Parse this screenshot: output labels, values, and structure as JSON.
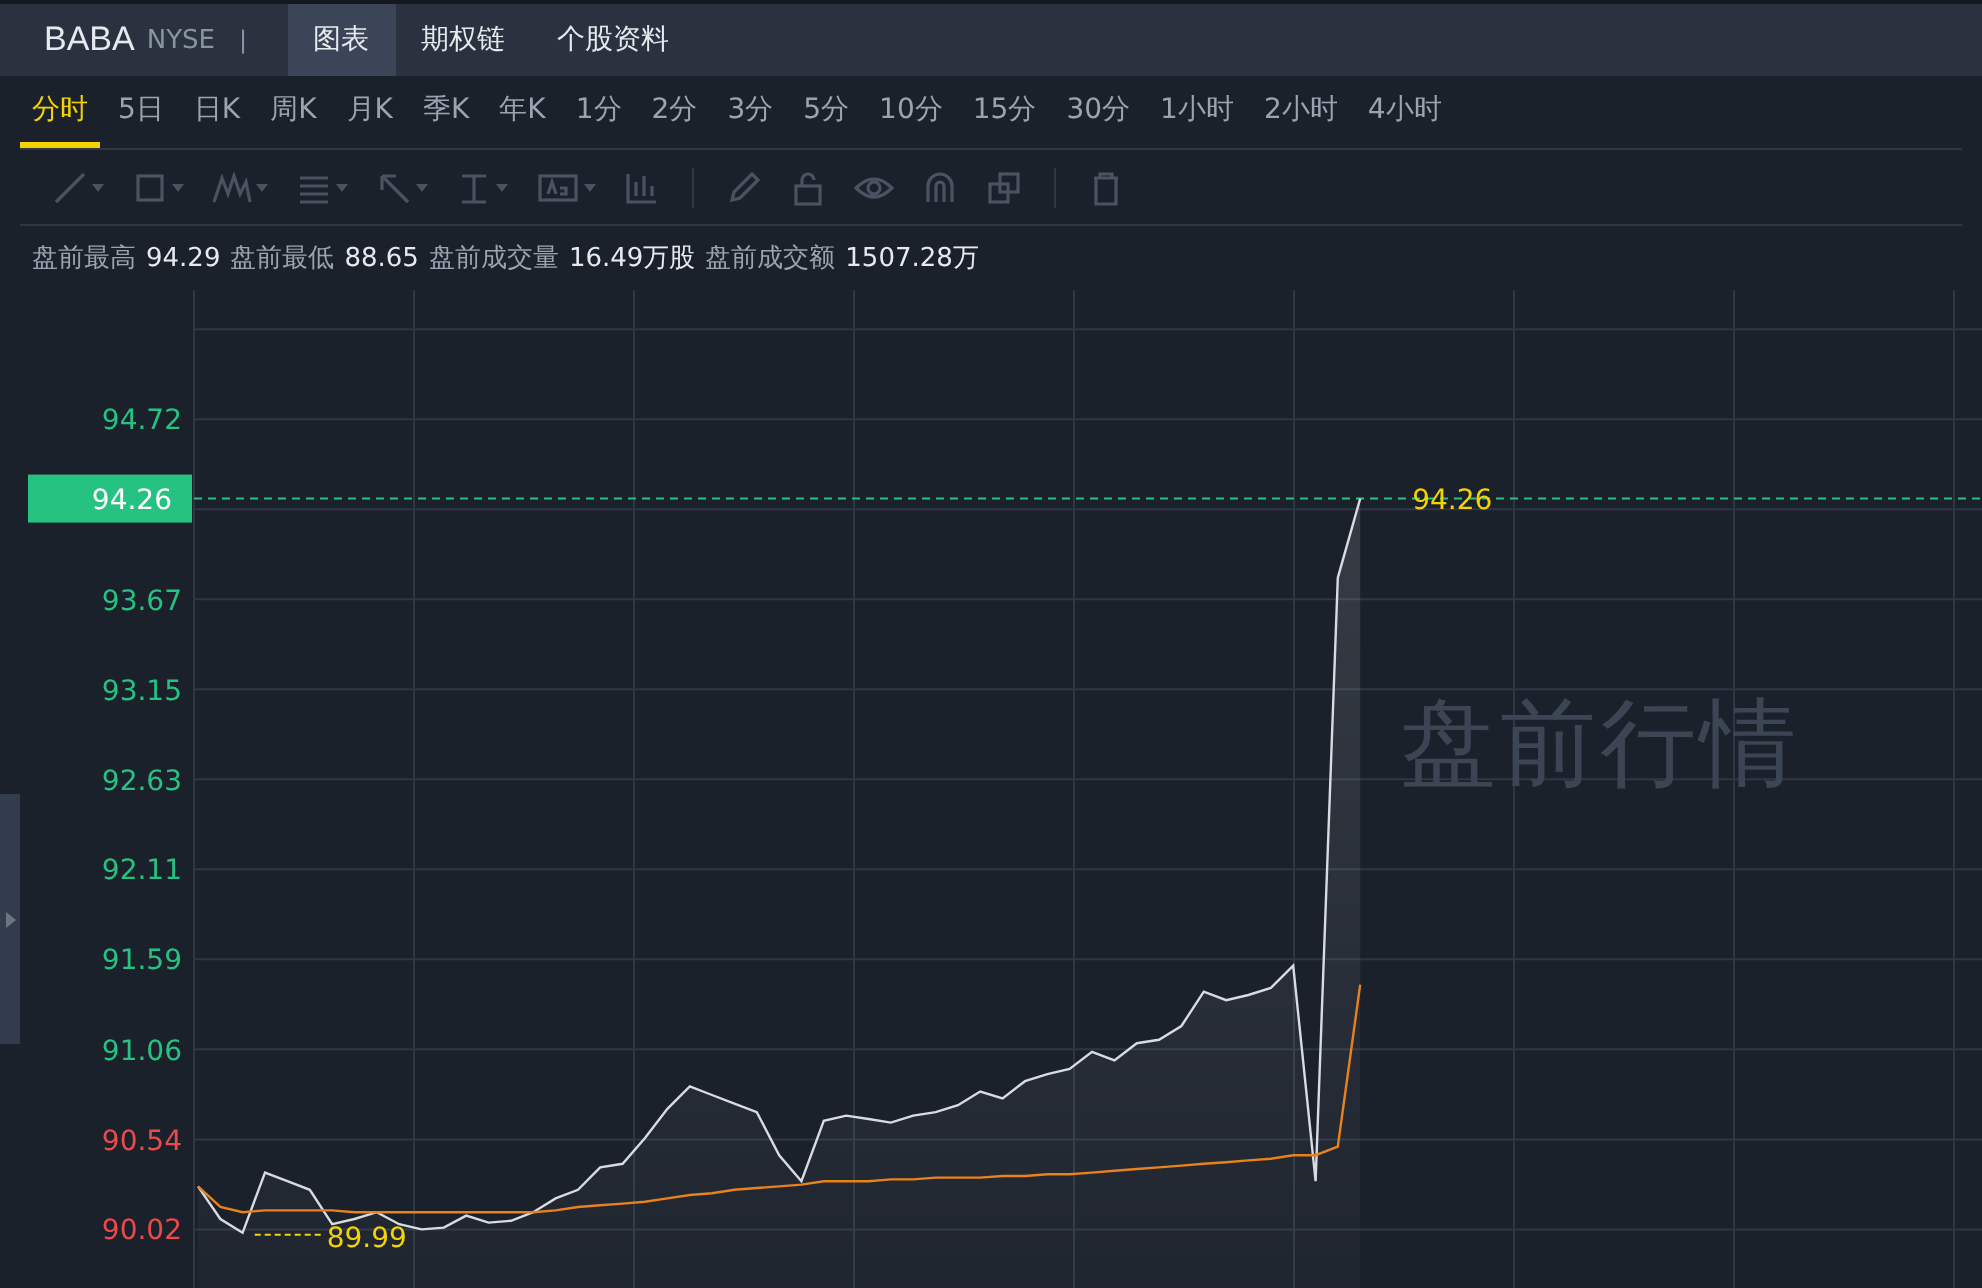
{
  "header": {
    "symbol": "BABA",
    "exchange": "NYSE",
    "separator": "|",
    "tabs": [
      {
        "label": "图表",
        "selected": true
      },
      {
        "label": "期权链",
        "selected": false
      },
      {
        "label": "个股资料",
        "selected": false
      }
    ]
  },
  "periods": [
    {
      "label": "分时",
      "selected": true
    },
    {
      "label": "5日",
      "selected": false
    },
    {
      "label": "日K",
      "selected": false
    },
    {
      "label": "周K",
      "selected": false
    },
    {
      "label": "月K",
      "selected": false
    },
    {
      "label": "季K",
      "selected": false
    },
    {
      "label": "年K",
      "selected": false
    },
    {
      "label": "1分",
      "selected": false
    },
    {
      "label": "2分",
      "selected": false
    },
    {
      "label": "3分",
      "selected": false
    },
    {
      "label": "5分",
      "selected": false
    },
    {
      "label": "10分",
      "selected": false
    },
    {
      "label": "15分",
      "selected": false
    },
    {
      "label": "30分",
      "selected": false
    },
    {
      "label": "1小时",
      "selected": false
    },
    {
      "label": "2小时",
      "selected": false
    },
    {
      "label": "4小时",
      "selected": false
    }
  ],
  "drawing_tools": [
    {
      "kind": "line",
      "menu": true
    },
    {
      "kind": "rect",
      "menu": true
    },
    {
      "kind": "pattern",
      "menu": true
    },
    {
      "kind": "fib",
      "menu": true
    },
    {
      "kind": "arrow",
      "menu": true
    },
    {
      "kind": "measure",
      "menu": true
    },
    {
      "kind": "text",
      "menu": true
    },
    {
      "kind": "bars",
      "menu": false
    },
    {
      "kind": "divider"
    },
    {
      "kind": "pencil",
      "menu": false
    },
    {
      "kind": "lock",
      "menu": false
    },
    {
      "kind": "eye",
      "menu": false
    },
    {
      "kind": "magnet",
      "menu": false
    },
    {
      "kind": "layers",
      "menu": false
    },
    {
      "kind": "divider"
    },
    {
      "kind": "trash",
      "menu": false
    }
  ],
  "stats": [
    {
      "label": "盘前最高",
      "value": "94.29"
    },
    {
      "label": "盘前最低",
      "value": "88.65"
    },
    {
      "label": "盘前成交量",
      "value": "16.49万股"
    },
    {
      "label": "盘前成交额",
      "value": "1507.28万"
    }
  ],
  "chart": {
    "watermark": "盘前行情",
    "tick_styles": [
      {
        "color": "#26c281"
      },
      {
        "color": "#26c281"
      },
      {
        "color": "#26c281"
      },
      {
        "color": "#26c281"
      },
      {
        "color": "#26c281"
      },
      {
        "color": "#26c281"
      },
      {
        "color": "#26c281"
      },
      {
        "color": "#e94a4a"
      },
      {
        "color": "#e94a4a"
      }
    ],
    "chart_data": {
      "type": "area",
      "grid": true,
      "ylim": [
        89.68,
        95.47
      ],
      "categories": [
        null,
        null,
        null,
        null,
        null,
        null,
        null,
        null,
        null,
        null,
        null,
        null,
        null,
        null,
        null,
        null,
        null,
        null,
        null,
        null,
        null,
        null,
        null,
        null,
        null,
        null,
        null,
        null,
        null,
        null,
        null,
        null,
        null,
        null,
        null,
        null,
        null,
        null,
        null,
        null,
        null,
        null,
        null,
        null,
        null,
        null,
        null,
        null,
        null,
        null,
        null,
        null,
        null
      ],
      "yticks": [
        {
          "value": 94.72,
          "label": "94.72"
        },
        {
          "value": 93.67,
          "label": "93.67"
        },
        {
          "value": 93.15,
          "label": "93.15"
        },
        {
          "value": 92.63,
          "label": "92.63"
        },
        {
          "value": 92.11,
          "label": "92.11"
        },
        {
          "value": 91.59,
          "label": "91.59"
        },
        {
          "value": 91.06,
          "label": "91.06"
        },
        {
          "value": 90.54,
          "label": "90.54"
        },
        {
          "value": 90.02,
          "label": "90.02"
        }
      ],
      "ref_lines": [
        {
          "axis": "y",
          "value": 94.26,
          "label": "94.26",
          "color": "#26c281"
        }
      ],
      "series": [
        {
          "type": "area",
          "color": "#d8dce2",
          "values": [
            90.27,
            90.08,
            90.0,
            90.35,
            90.3,
            90.25,
            90.05,
            90.08,
            90.12,
            90.05,
            90.02,
            90.03,
            90.1,
            90.06,
            90.07,
            90.12,
            90.2,
            90.25,
            90.38,
            90.4,
            90.55,
            90.72,
            90.85,
            90.8,
            90.75,
            90.7,
            90.45,
            90.3,
            90.65,
            90.68,
            90.66,
            90.64,
            90.68,
            90.7,
            90.74,
            90.82,
            90.78,
            90.88,
            90.92,
            90.95,
            91.05,
            91.0,
            91.1,
            91.12,
            91.2,
            91.4,
            91.35,
            91.38,
            91.42,
            91.55,
            90.3,
            93.8,
            94.26
          ]
        },
        {
          "type": "line",
          "color": "#e8821e",
          "values": [
            90.27,
            90.15,
            90.12,
            90.13,
            90.13,
            90.13,
            90.13,
            90.12,
            90.12,
            90.12,
            90.12,
            90.12,
            90.12,
            90.12,
            90.12,
            90.12,
            90.13,
            90.15,
            90.16,
            90.17,
            90.18,
            90.2,
            90.22,
            90.23,
            90.25,
            90.26,
            90.27,
            90.28,
            90.3,
            90.3,
            90.3,
            90.31,
            90.31,
            90.32,
            90.32,
            90.32,
            90.33,
            90.33,
            90.34,
            90.34,
            90.35,
            90.36,
            90.37,
            90.38,
            90.39,
            90.4,
            90.41,
            90.42,
            90.43,
            90.45,
            90.45,
            90.5,
            91.44
          ]
        }
      ],
      "annotations": [
        "94.26",
        "89.99"
      ]
    }
  }
}
